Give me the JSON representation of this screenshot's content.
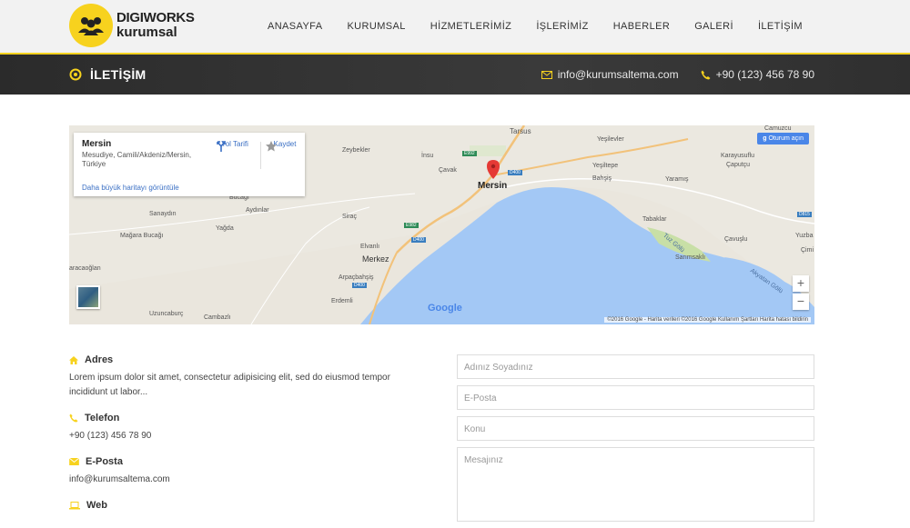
{
  "brand": {
    "line1": "DIGIWORKS",
    "line2": "kurumsal"
  },
  "nav": [
    {
      "label": "ANASAYFA"
    },
    {
      "label": "KURUMSAL"
    },
    {
      "label": "HİZMETLERİMİZ"
    },
    {
      "label": "İŞLERİMİZ"
    },
    {
      "label": "HABERLER"
    },
    {
      "label": "GALERİ"
    },
    {
      "label": "İLETİŞİM"
    }
  ],
  "page": {
    "title": "İLETİŞİM",
    "email": "info@kurumsaltema.com",
    "phone": "+90 (123) 456 78 90"
  },
  "map": {
    "card": {
      "city": "Mersin",
      "address": "Mesudiye, Camili/Akdeniz/Mersin, Türkiye",
      "directions": "Yol Tarifi",
      "save": "Kaydet",
      "bigger_map": "Daha büyük haritayı görüntüle"
    },
    "signin": "Oturum açın",
    "zoom_in": "+",
    "zoom_out": "−",
    "google": "Google",
    "attribution": "©2016 Google - Harita verileri ©2016 Google   Kullanım Şartları   Harita hatası bildirin",
    "labels": {
      "tarsus": "Tarsus",
      "yeslevler": "Yeşilevler",
      "insu": "İnsu",
      "zeybekler": "Zeybekler",
      "cavak": "Çavak",
      "mersin": "Mersin",
      "yesiltepe": "Yeşiltepe",
      "bahsis": "Bahşiş",
      "yaramis": "Yaramış",
      "karayusuflu": "Karayusuflu",
      "caputcu": "Çaputçu",
      "bucagi": "Bucağı",
      "aydinlar": "Aydınlar",
      "sanaydin": "Sanaydın",
      "yagda": "Yağda",
      "siraç": "Siraç",
      "magara": "Mağara Bucağı",
      "elvanli": "Elvanlı",
      "merkez": "Merkez",
      "arpacbahsis": "Arpaçbahşiş",
      "erdemli": "Erdemli",
      "tabaklar": "Tabaklar",
      "cavuslu": "Çavuşlu",
      "sarimsakli": "Sarımsaklı",
      "kacaoglan": "aracaoğlan",
      "uzuncaburc": "Uzuncaburç",
      "cambazli": "Cambazlı",
      "tuzgolu": "Tuz Gölü",
      "akyatan": "Akyatan Gölü",
      "yuzba": "Yuzba",
      "cimi": "Çimi",
      "camuzcu": "Camuzcu"
    },
    "roads": {
      "e992": "E992",
      "d400a": "D400",
      "e982": "E982",
      "d400b": "D400",
      "d400c": "D400",
      "d815": "D815"
    }
  },
  "contact": {
    "address_title": "Adres",
    "address_text": "Lorem ipsum dolor sit amet, consectetur adipisicing elit, sed do eiusmod tempor incididunt ut labor...",
    "phone_title": "Telefon",
    "phone_text": "+90 (123) 456 78 90",
    "email_title": "E-Posta",
    "email_text": "info@kurumsaltema.com",
    "web_title": "Web"
  },
  "form": {
    "name": "Adınız Soyadınız",
    "email": "E-Posta",
    "subject": "Konu",
    "message": "Mesajınız"
  },
  "colors": {
    "accent": "#f7d21e",
    "band": "#2b2b2b",
    "link": "#3a6fc4"
  }
}
